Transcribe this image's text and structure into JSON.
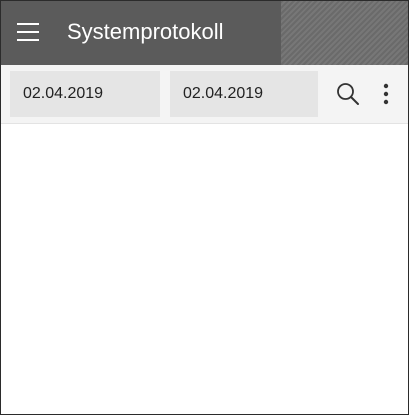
{
  "appbar": {
    "title": "Systemprotokoll",
    "menu_icon": "menu-icon"
  },
  "filter": {
    "date_from": "02.04.2019",
    "date_to": "02.04.2019",
    "search_icon": "search-icon",
    "more_icon": "more-vert-icon"
  }
}
